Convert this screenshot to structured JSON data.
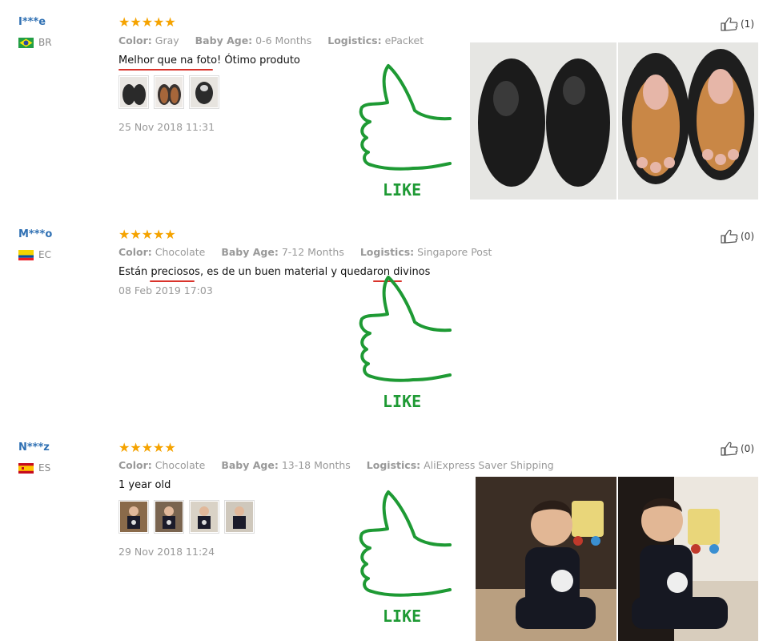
{
  "reviews": [
    {
      "user": "I***e",
      "country": "BR",
      "stars": "★★★★★",
      "attrs": [
        {
          "label": "Color:",
          "value": "Gray"
        },
        {
          "label": "Baby Age:",
          "value": "0-6 Months"
        },
        {
          "label": "Logistics:",
          "value": "ePacket"
        }
      ],
      "text": "Melhor que na foto! Ótimo produto",
      "date": "25 Nov 2018 11:31",
      "helpful_count": "(1)",
      "like_label": "LIKE"
    },
    {
      "user": "M***o",
      "country": "EC",
      "stars": "★★★★★",
      "attrs": [
        {
          "label": "Color:",
          "value": "Chocolate"
        },
        {
          "label": "Baby Age:",
          "value": "7-12 Months"
        },
        {
          "label": "Logistics:",
          "value": "Singapore Post"
        }
      ],
      "text": "Están preciosos, es de un buen material y quedaron divinos",
      "date": "08 Feb 2019 17:03",
      "helpful_count": "(0)",
      "like_label": "LIKE"
    },
    {
      "user": "N***z",
      "country": "ES",
      "stars": "★★★★★",
      "attrs": [
        {
          "label": "Color:",
          "value": "Chocolate"
        },
        {
          "label": "Baby Age:",
          "value": "13-18 Months"
        },
        {
          "label": "Logistics:",
          "value": "AliExpress Saver Shipping"
        }
      ],
      "text": "1 year old",
      "date": "29 Nov 2018 11:24",
      "helpful_count": "(0)",
      "like_label": "LIKE"
    }
  ],
  "colors": {
    "username": "#2f70b3",
    "star": "#f5a300",
    "like_green": "#1e9a34",
    "underline_red": "#d9332b"
  },
  "icons": {
    "helpful": "thumbs-up-outline-icon",
    "like": "hand-drawn-thumbs-up-icon"
  }
}
